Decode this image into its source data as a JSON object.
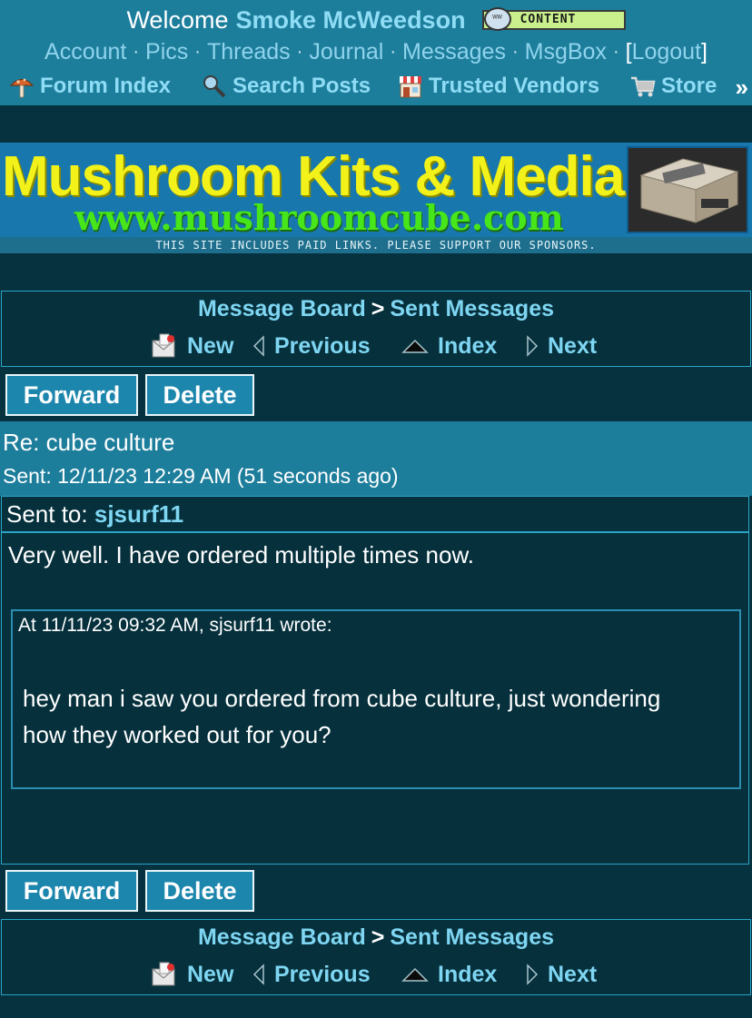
{
  "header": {
    "welcome_text": "Welcome",
    "username": "Smoke McWeedson",
    "badge_label": "CONTENT",
    "account_links": [
      "Account",
      "Pics",
      "Threads",
      "Journal",
      "Messages",
      "MsgBox"
    ],
    "logout_label": "Logout",
    "forum_links": [
      {
        "label": "Forum Index",
        "icon": "mushroom-icon"
      },
      {
        "label": "Search Posts",
        "icon": "magnifier-icon"
      },
      {
        "label": "Trusted Vendors",
        "icon": "storefront-icon"
      },
      {
        "label": "Store",
        "icon": "shopping-cart-icon"
      }
    ],
    "more_label": "»"
  },
  "banner": {
    "title": "Mushroom Kits & Media",
    "url": "www.mushroomcube.com",
    "disclaimer": "THIS SITE INCLUDES PAID LINKS. PLEASE SUPPORT OUR SPONSORS."
  },
  "nav": {
    "crumb_board": "Message Board",
    "crumb_sep": ">",
    "crumb_current": "Sent Messages",
    "new_label": "New",
    "previous_label": "Previous",
    "index_label": "Index",
    "next_label": "Next"
  },
  "actions": {
    "forward_label": "Forward",
    "delete_label": "Delete"
  },
  "message": {
    "subject": "Re: cube culture",
    "sent": "Sent: 12/11/23 12:29 AM (51 seconds ago)",
    "sent_to_label": "Sent to:",
    "recipient": "sjsurf11",
    "body": "Very well. I have ordered multiple times now.",
    "quote_header": "At 11/11/23 09:32 AM, sjsurf11 wrote:",
    "quote_body": "hey man i saw you ordered from cube culture, just wondering how they worked out for you?"
  },
  "colors": {
    "page_bg": "#06313e",
    "header_bg": "#1d7e9c",
    "link": "#7fd6f2",
    "banner_title": "#f2f21a",
    "banner_url": "#47e61b"
  }
}
